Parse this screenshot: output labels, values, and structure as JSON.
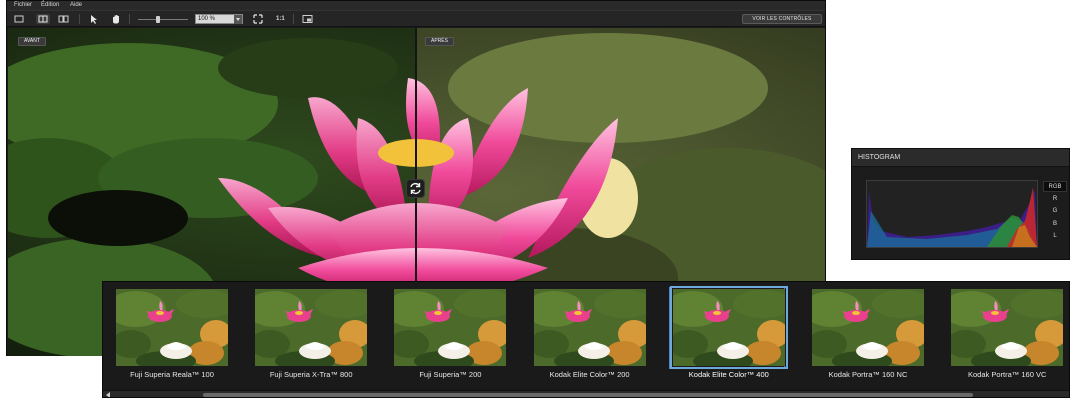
{
  "menu": {
    "file": "Fichier",
    "edit": "Édition",
    "help": "Aide"
  },
  "toolbar": {
    "zoom_value": "100 %",
    "actual_size_label": "1:1",
    "controls_button": "VOIR LES CONTRÔLES",
    "tools": [
      "single-view-icon",
      "split-view-icon",
      "side-by-side-icon",
      "pointer-icon",
      "hand-icon",
      "fit-screen-icon",
      "compare-icon"
    ]
  },
  "preview": {
    "before_label": "AVANT",
    "after_label": "APRÈS",
    "split_position": 0.5
  },
  "histogram": {
    "title": "HISTOGRAM",
    "channels": [
      "RGB",
      "R",
      "G",
      "B",
      "L"
    ],
    "selected_channel": "RGB"
  },
  "films": [
    {
      "name": "Fuji Superia Reala™ 100",
      "selected": false
    },
    {
      "name": "Fuji Superia X-Tra™ 800",
      "selected": false
    },
    {
      "name": "Fuji Superia™ 200",
      "selected": false
    },
    {
      "name": "Kodak Elite Color™ 200",
      "selected": false
    },
    {
      "name": "Kodak Elite Color™ 400",
      "selected": true
    },
    {
      "name": "Kodak Portra™ 160 NC",
      "selected": false
    },
    {
      "name": "Kodak Portra™ 160 VC",
      "selected": false
    }
  ],
  "colors": {
    "accent": "#4a86c8",
    "window_bg": "#1b1b1b",
    "lotus": "#e0337f"
  }
}
